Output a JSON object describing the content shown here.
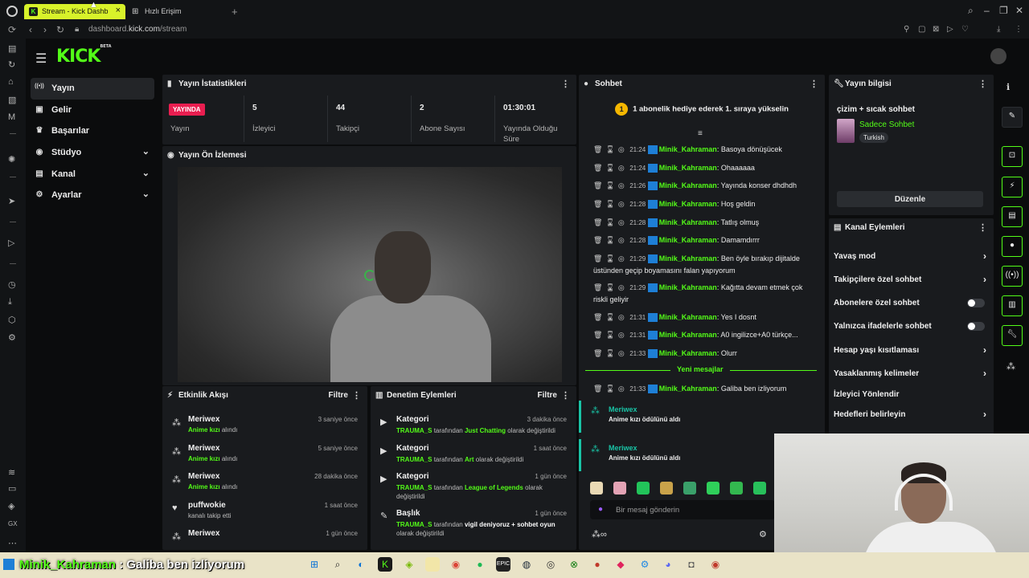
{
  "browser": {
    "tabs": [
      {
        "label": "Stream - Kick Dashb"
      },
      {
        "label": "Hızlı Erişim"
      }
    ],
    "url_prefix": "dashboard.",
    "url_domain": "kick.com",
    "url_path": "/stream"
  },
  "brand": {
    "logo": "KICK",
    "tag": "BETA",
    "accent": "#53fc18"
  },
  "nav": [
    {
      "label": "Yayın",
      "icon": "broadcast-icon",
      "glyph": "((•))"
    },
    {
      "label": "Gelir",
      "icon": "wallet-icon",
      "glyph": "▣"
    },
    {
      "label": "Başarılar",
      "icon": "trophy-icon",
      "glyph": "♛"
    },
    {
      "label": "Stüdyo",
      "icon": "studio-icon",
      "glyph": "◉"
    },
    {
      "label": "Kanal",
      "icon": "channel-icon",
      "glyph": "▤"
    },
    {
      "label": "Ayarlar",
      "icon": "gear-icon",
      "glyph": "⚙"
    }
  ],
  "stats": {
    "title": "Yayın İstatistikleri",
    "live_badge": "YAYINDA",
    "live_label": "Yayın",
    "viewers_value": "5",
    "viewers_label": "İzleyici",
    "followers_value": "44",
    "followers_label": "Takipçi",
    "subs_value": "2",
    "subs_label": "Abone Sayısı",
    "uptime_value": "01:30:01",
    "uptime_label": "Yayında Olduğu Süre"
  },
  "preview": {
    "title": "Yayın Ön İzlemesi"
  },
  "activity": {
    "title": "Etkinlik Akışı",
    "filter": "Filtre",
    "items": [
      {
        "name": "Meriwex",
        "desc": "Anime kızı",
        "action": "alındı",
        "time": "3 saniye önce"
      },
      {
        "name": "Meriwex",
        "desc": "Anime kızı",
        "action": "alındı",
        "time": "5 saniye önce"
      },
      {
        "name": "Meriwex",
        "desc": "Anime kızı",
        "action": "alındı",
        "time": "28 dakika önce"
      },
      {
        "name": "puffwokie",
        "desc": "",
        "action": "kanalı takip etti",
        "time": "1 saat önce"
      },
      {
        "name": "Meriwex",
        "desc": "",
        "action": "",
        "time": "1 gün önce"
      }
    ]
  },
  "moderation": {
    "title": "Denetim Eylemleri",
    "filter": "Filtre",
    "items": [
      {
        "type": "Kategori",
        "user": "TRAUMA_S",
        "mid": "tarafından",
        "value": "Just Chatting",
        "end": "olarak değiştirildi",
        "time": "3 dakika önce"
      },
      {
        "type": "Kategori",
        "user": "TRAUMA_S",
        "mid": "tarafından",
        "value": "Art",
        "end": "olarak değiştirildi",
        "time": "1 saat önce"
      },
      {
        "type": "Kategori",
        "user": "TRAUMA_S",
        "mid": "tarafından",
        "value": "League of Legends",
        "end": "olarak değiştirildi",
        "time": "1 gün önce"
      },
      {
        "type": "Başlık",
        "user": "TRAUMA_S",
        "mid": "tarafından",
        "value": "vigil deniyoruz + sohbet oyun",
        "end": "olarak değiştirildi",
        "time": "1 gün önce"
      }
    ]
  },
  "chat": {
    "title": "Sohbet",
    "pinned_rank": "1",
    "pinned": "1 abonelik hediye ederek 1. sıraya yükselin",
    "messages": [
      {
        "time": "21:24",
        "user": "Minik_Kahraman",
        "text": "Basoya dönüşücek"
      },
      {
        "time": "21:24",
        "user": "Minik_Kahraman",
        "text": "Ohaaaaaa"
      },
      {
        "time": "21:26",
        "user": "Minik_Kahraman",
        "text": "Yayında konser dhdhdh"
      },
      {
        "time": "21:28",
        "user": "Minik_Kahraman",
        "text": "Hoş geldin"
      },
      {
        "time": "21:28",
        "user": "Minik_Kahraman",
        "text": "Tatlış olmuş"
      },
      {
        "time": "21:28",
        "user": "Minik_Kahraman",
        "text": "Damamdırrr"
      },
      {
        "time": "21:29",
        "user": "Minik_Kahraman",
        "text": "Ben öyle bırakıp dijitalde üstünden geçip boyamasını falan yapıyorum"
      },
      {
        "time": "21:29",
        "user": "Minik_Kahraman",
        "text": "Kağıtta devam etmek çok riskli geliyir"
      },
      {
        "time": "21:31",
        "user": "Minik_Kahraman",
        "text": "Yes I dosnt"
      },
      {
        "time": "21:31",
        "user": "Minik_Kahraman",
        "text": "A0 ingilizce+A0 türkçe..."
      },
      {
        "time": "21:33",
        "user": "Minik_Kahraman",
        "text": "Olurr"
      }
    ],
    "new_messages_label": "Yeni mesajlar",
    "new_message": {
      "time": "21:33",
      "user": "Minik_Kahraman",
      "text": "Galiba ben izliyorum"
    },
    "rewards": [
      {
        "name": "Meriwex",
        "desc": "Anime kızı ödülünü aldı"
      },
      {
        "name": "Meriwex",
        "desc": "Anime kızı ödülünü aldı"
      }
    ],
    "input_placeholder": "Bir mesaj gönderin"
  },
  "info": {
    "title": "Yayın bilgisi",
    "stream_title": "çizim + sıcak sohbet",
    "category": "Sadece Sohbet",
    "language": "Turkish",
    "edit": "Düzenle"
  },
  "channel_actions": {
    "title": "Kanal Eylemleri",
    "rows": [
      {
        "label": "Yavaş mod",
        "kind": "arrow"
      },
      {
        "label": "Takipçilere özel sohbet",
        "kind": "arrow"
      },
      {
        "label": "Abonelere özel sohbet",
        "kind": "toggle",
        "on": false
      },
      {
        "label": "Yalnızca ifadelerle sohbet",
        "kind": "toggle",
        "on": false
      },
      {
        "label": "Hesap yaşı kısıtlaması",
        "kind": "arrow"
      },
      {
        "label": "Yasaklanmış kelimeler",
        "kind": "arrow"
      },
      {
        "label": "İzleyici Yönlendir",
        "kind": "none"
      },
      {
        "label": "Hedefleri belirleyin",
        "kind": "arrow"
      }
    ]
  },
  "ticker": {
    "user": "Minik_Kahraman",
    "sep": ":",
    "text": "Galiba ben izliyorum"
  }
}
